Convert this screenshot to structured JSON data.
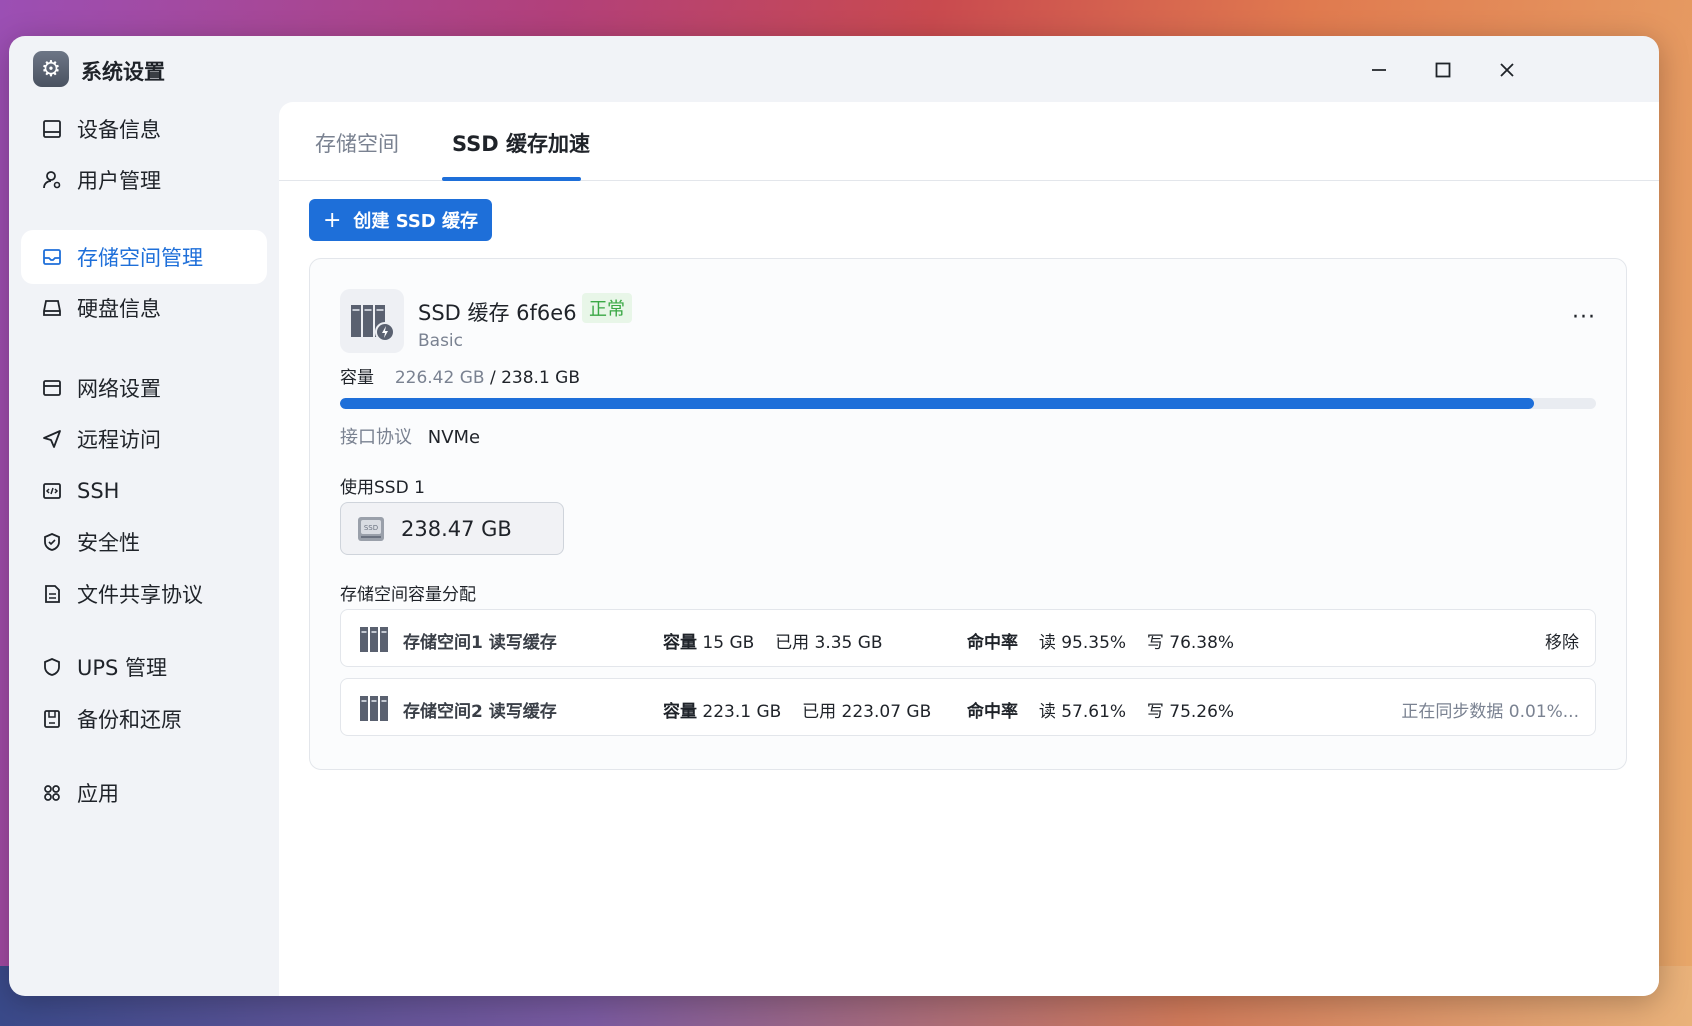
{
  "window": {
    "title": "系统设置"
  },
  "controls": {
    "minimize": "—",
    "maximize": "☐",
    "close": "✕"
  },
  "sidebar": {
    "items": [
      {
        "label": "设备信息",
        "icon": "monitor-icon",
        "active": false
      },
      {
        "label": "用户管理",
        "icon": "user-gear-icon",
        "active": false
      },
      {
        "label": "存储空间管理",
        "icon": "storage-icon",
        "active": true
      },
      {
        "label": "硬盘信息",
        "icon": "disk-icon",
        "active": false
      },
      {
        "label": "网络设置",
        "icon": "network-icon",
        "active": false
      },
      {
        "label": "远程访问",
        "icon": "send-icon",
        "active": false
      },
      {
        "label": "SSH",
        "icon": "code-icon",
        "active": false
      },
      {
        "label": "安全性",
        "icon": "shield-check-icon",
        "active": false
      },
      {
        "label": "文件共享协议",
        "icon": "file-icon",
        "active": false
      },
      {
        "label": "UPS 管理",
        "icon": "shield-icon",
        "active": false
      },
      {
        "label": "备份和还原",
        "icon": "backup-icon",
        "active": false
      },
      {
        "label": "应用",
        "icon": "apps-icon",
        "active": false
      }
    ]
  },
  "tabs": [
    {
      "label": "存储空间",
      "active": false
    },
    {
      "label": "SSD 缓存加速",
      "active": true
    }
  ],
  "toolbar": {
    "create_label": "创建 SSD 缓存",
    "plus": "+"
  },
  "cache": {
    "title": "SSD 缓存 6f6e6",
    "status": "正常",
    "subtitle": "Basic",
    "more": "···",
    "capacity_label": "容量",
    "capacity_used": "226.42 GB",
    "capacity_sep": " / ",
    "capacity_total": "238.1 GB",
    "capacity_fraction": 0.951,
    "interface_label": "接口协议",
    "interface_value": "NVMe",
    "used_ssd_label": "使用SSD 1",
    "ssd_size": "238.47 GB",
    "alloc_label": "存储空间容量分配",
    "allocations": [
      {
        "name": "存储空间1  读写缓存",
        "cap_label": "容量",
        "cap_value": "15 GB",
        "used_label": "已用",
        "used_value": "3.35 GB",
        "hit_label": "命中率",
        "read_label": "读",
        "read_value": "95.35%",
        "write_label": "写",
        "write_value": "76.38%",
        "action": "移除"
      },
      {
        "name": "存储空间2  读写缓存",
        "cap_label": "容量",
        "cap_value": "223.1 GB",
        "used_label": "已用",
        "used_value": "223.07 GB",
        "hit_label": "命中率",
        "read_label": "读",
        "read_value": "57.61%",
        "write_label": "写",
        "write_value": "75.26%",
        "action": "正在同步数据 0.01%..."
      }
    ]
  },
  "colors": {
    "accent": "#1e6fd9",
    "status_ok": "#3aa845"
  }
}
